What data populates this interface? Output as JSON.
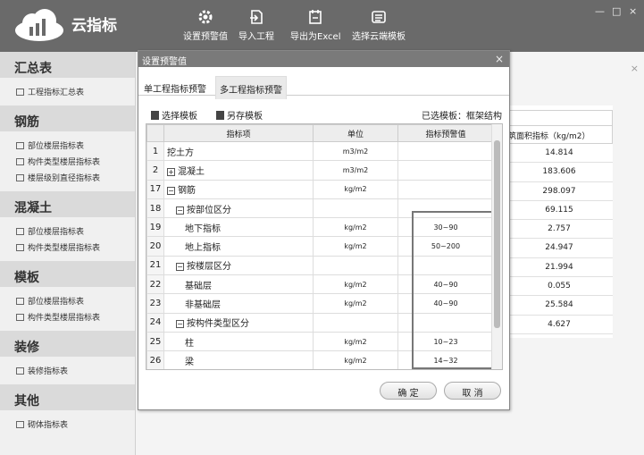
{
  "app": {
    "title": "云指标"
  },
  "toolbar": [
    {
      "label": "设置预警值",
      "icon": "gear-icon"
    },
    {
      "label": "导入工程",
      "icon": "import-icon"
    },
    {
      "label": "导出为Excel",
      "icon": "export-icon"
    },
    {
      "label": "选择云端模板",
      "icon": "template-icon"
    }
  ],
  "window_controls": {
    "minimize": "—",
    "maximize": "□",
    "close": "×"
  },
  "sidebar": [
    {
      "title": "汇总表",
      "items": [
        "工程指标汇总表"
      ]
    },
    {
      "title": "钢筋",
      "items": [
        "部位楼层指标表",
        "构件类型楼层指标表",
        "楼层级别直径指标表"
      ]
    },
    {
      "title": "混凝土",
      "items": [
        "部位楼层指标表",
        "构件类型楼层指标表"
      ]
    },
    {
      "title": "模板",
      "items": [
        "部位楼层指标表",
        "构件类型楼层指标表"
      ]
    },
    {
      "title": "装修",
      "items": [
        "装修指标表"
      ]
    },
    {
      "title": "其他",
      "items": [
        "砌体指标表"
      ]
    }
  ],
  "background_table": {
    "header": "筑面积指标（kg/m2）",
    "values": [
      "14.814",
      "183.606",
      "298.097",
      "69.115",
      "2.757",
      "24.947",
      "21.994",
      "0.055",
      "25.584",
      "4.627"
    ],
    "close": "×"
  },
  "dialog": {
    "title": "设置预警值",
    "close": "×",
    "tabs": [
      "单工程指标预警",
      "多工程指标预警"
    ],
    "select_template": "选择模板",
    "save_template": "另存模板",
    "selected_template_label": "已选模板：",
    "selected_template": "框架结构",
    "columns": [
      "指标项",
      "单位",
      "指标预警值"
    ],
    "rows": [
      {
        "num": "1",
        "indent": 0,
        "exp": "",
        "name": "挖土方",
        "unit": "m3/m2",
        "value": ""
      },
      {
        "num": "2",
        "indent": 0,
        "exp": "+",
        "name": "混凝土",
        "unit": "m3/m2",
        "value": ""
      },
      {
        "num": "17",
        "indent": 0,
        "exp": "−",
        "name": "钢筋",
        "unit": "kg/m2",
        "value": ""
      },
      {
        "num": "18",
        "indent": 1,
        "exp": "−",
        "name": "按部位区分",
        "unit": "",
        "value": ""
      },
      {
        "num": "19",
        "indent": 2,
        "exp": "",
        "name": "地下指标",
        "unit": "kg/m2",
        "value": "30~90"
      },
      {
        "num": "20",
        "indent": 2,
        "exp": "",
        "name": "地上指标",
        "unit": "kg/m2",
        "value": "50~200"
      },
      {
        "num": "21",
        "indent": 1,
        "exp": "−",
        "name": "按楼层区分",
        "unit": "",
        "value": ""
      },
      {
        "num": "22",
        "indent": 2,
        "exp": "",
        "name": "基础层",
        "unit": "kg/m2",
        "value": "40~90"
      },
      {
        "num": "23",
        "indent": 2,
        "exp": "",
        "name": "非基础层",
        "unit": "kg/m2",
        "value": "40~90"
      },
      {
        "num": "24",
        "indent": 1,
        "exp": "−",
        "name": "按构件类型区分",
        "unit": "",
        "value": ""
      },
      {
        "num": "25",
        "indent": 2,
        "exp": "",
        "name": "柱",
        "unit": "kg/m2",
        "value": "10~23"
      },
      {
        "num": "26",
        "indent": 2,
        "exp": "",
        "name": "梁",
        "unit": "kg/m2",
        "value": "14~32"
      }
    ],
    "ok": "确 定",
    "cancel": "取 消"
  }
}
